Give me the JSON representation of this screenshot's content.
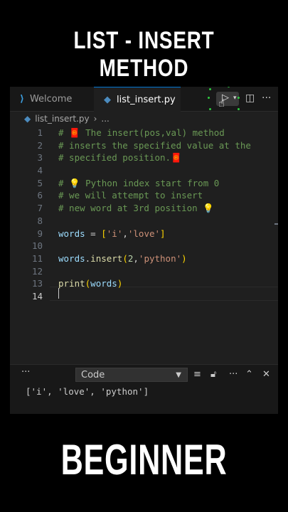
{
  "headline_top": "LIST - INSERT METHOD",
  "headline_bottom": "BEGINNER",
  "tabs": [
    {
      "label": "Welcome",
      "icon": "vscode-icon"
    },
    {
      "label": "list_insert.py",
      "icon": "python-icon"
    }
  ],
  "breadcrumb": {
    "file": "list_insert.py",
    "more": "..."
  },
  "line_numbers": [
    "1",
    "2",
    "3",
    "4",
    "5",
    "6",
    "7",
    "8",
    "9",
    "10",
    "11",
    "12",
    "13",
    "14"
  ],
  "code_lines": [
    "# 🧧 The insert(pos,val) method",
    "# inserts the specified value at the",
    "# specified position.🧧",
    "",
    "# 💡 Python index start from 0",
    "# we will attempt to insert",
    "# new word at 3rd position 💡",
    "",
    "words = ['i','love']",
    "",
    "words.insert(2,'python')",
    "",
    "print(words)",
    ""
  ],
  "panel": {
    "more_label": "···",
    "dropdown_value": "Code",
    "output": "['i', 'love', 'python']"
  },
  "colors": {
    "accent": "#0078d4",
    "comment": "#6a9955",
    "string": "#ce9178",
    "variable": "#9cdcfe",
    "function": "#dcdcaa"
  }
}
